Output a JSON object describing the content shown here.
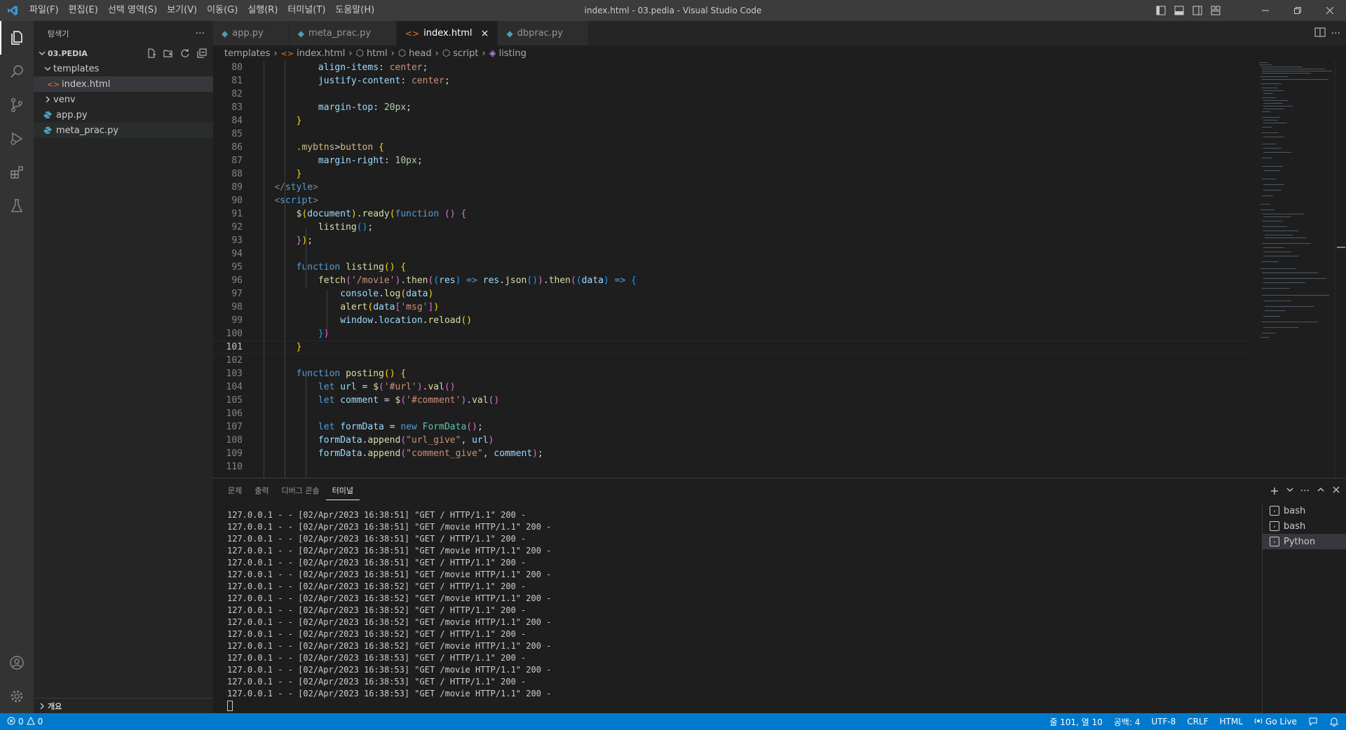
{
  "window": {
    "title": "index.html - 03.pedia - Visual Studio Code",
    "menu": [
      "파일(F)",
      "편집(E)",
      "선택 영역(S)",
      "보기(V)",
      "이동(G)",
      "실행(R)",
      "터미널(T)",
      "도움말(H)"
    ]
  },
  "sidebar": {
    "title": "탐색기",
    "more": "···",
    "folder": "03.PEDIA",
    "tree": [
      {
        "name": "templates",
        "type": "folder-open"
      },
      {
        "name": "index.html",
        "type": "html-file"
      },
      {
        "name": "venv",
        "type": "folder-closed"
      },
      {
        "name": "app.py",
        "type": "py-file"
      },
      {
        "name": "meta_prac.py",
        "type": "py-file"
      }
    ],
    "outline": "개요"
  },
  "tabs": [
    {
      "label": "app.py",
      "icon": "python-icon"
    },
    {
      "label": "meta_prac.py",
      "icon": "python-icon"
    },
    {
      "label": "index.html",
      "icon": "html-icon"
    },
    {
      "label": "dbprac.py",
      "icon": "python-icon"
    }
  ],
  "breadcrumbs": [
    "templates",
    "index.html",
    "html",
    "head",
    "script",
    "listing"
  ],
  "editor": {
    "line_numbers": [
      "80",
      "81",
      "82",
      "83",
      "84",
      "85",
      "86",
      "87",
      "88",
      "89",
      "90",
      "91",
      "92",
      "93",
      "94",
      "95",
      "96",
      "97",
      "98",
      "99",
      "100",
      "101",
      "102",
      "103",
      "104",
      "105",
      "106",
      "107",
      "108",
      "109",
      "110"
    ],
    "current_line": "101"
  },
  "panel": {
    "tabs": [
      "문제",
      "출력",
      "디버그 콘솔",
      "터미널"
    ],
    "active_tab": "터미널",
    "terminal_lines": [
      "127.0.0.1 - - [02/Apr/2023 16:38:51] \"GET / HTTP/1.1\" 200 -",
      "127.0.0.1 - - [02/Apr/2023 16:38:51] \"GET /movie HTTP/1.1\" 200 -",
      "127.0.0.1 - - [02/Apr/2023 16:38:51] \"GET / HTTP/1.1\" 200 -",
      "127.0.0.1 - - [02/Apr/2023 16:38:51] \"GET /movie HTTP/1.1\" 200 -",
      "127.0.0.1 - - [02/Apr/2023 16:38:51] \"GET / HTTP/1.1\" 200 -",
      "127.0.0.1 - - [02/Apr/2023 16:38:51] \"GET /movie HTTP/1.1\" 200 -",
      "127.0.0.1 - - [02/Apr/2023 16:38:52] \"GET / HTTP/1.1\" 200 -",
      "127.0.0.1 - - [02/Apr/2023 16:38:52] \"GET /movie HTTP/1.1\" 200 -",
      "127.0.0.1 - - [02/Apr/2023 16:38:52] \"GET / HTTP/1.1\" 200 -",
      "127.0.0.1 - - [02/Apr/2023 16:38:52] \"GET /movie HTTP/1.1\" 200 -",
      "127.0.0.1 - - [02/Apr/2023 16:38:52] \"GET / HTTP/1.1\" 200 -",
      "127.0.0.1 - - [02/Apr/2023 16:38:52] \"GET /movie HTTP/1.1\" 200 -",
      "127.0.0.1 - - [02/Apr/2023 16:38:53] \"GET / HTTP/1.1\" 200 -",
      "127.0.0.1 - - [02/Apr/2023 16:38:53] \"GET /movie HTTP/1.1\" 200 -",
      "127.0.0.1 - - [02/Apr/2023 16:38:53] \"GET / HTTP/1.1\" 200 -",
      "127.0.0.1 - - [02/Apr/2023 16:38:53] \"GET /movie HTTP/1.1\" 200 -"
    ],
    "terminals": [
      "bash",
      "bash",
      "Python"
    ]
  },
  "statusbar": {
    "errors": "0",
    "warnings": "0",
    "position": "줄 101, 열 10",
    "spaces": "공백: 4",
    "encoding": "UTF-8",
    "eol": "CRLF",
    "language": "HTML",
    "golive": "Go Live"
  },
  "colors": {
    "statusbar": "#007acc",
    "activitybar": "#333333",
    "sidebar": "#252526",
    "editor": "#1e1e1e",
    "titlebar": "#3c3c3c"
  }
}
